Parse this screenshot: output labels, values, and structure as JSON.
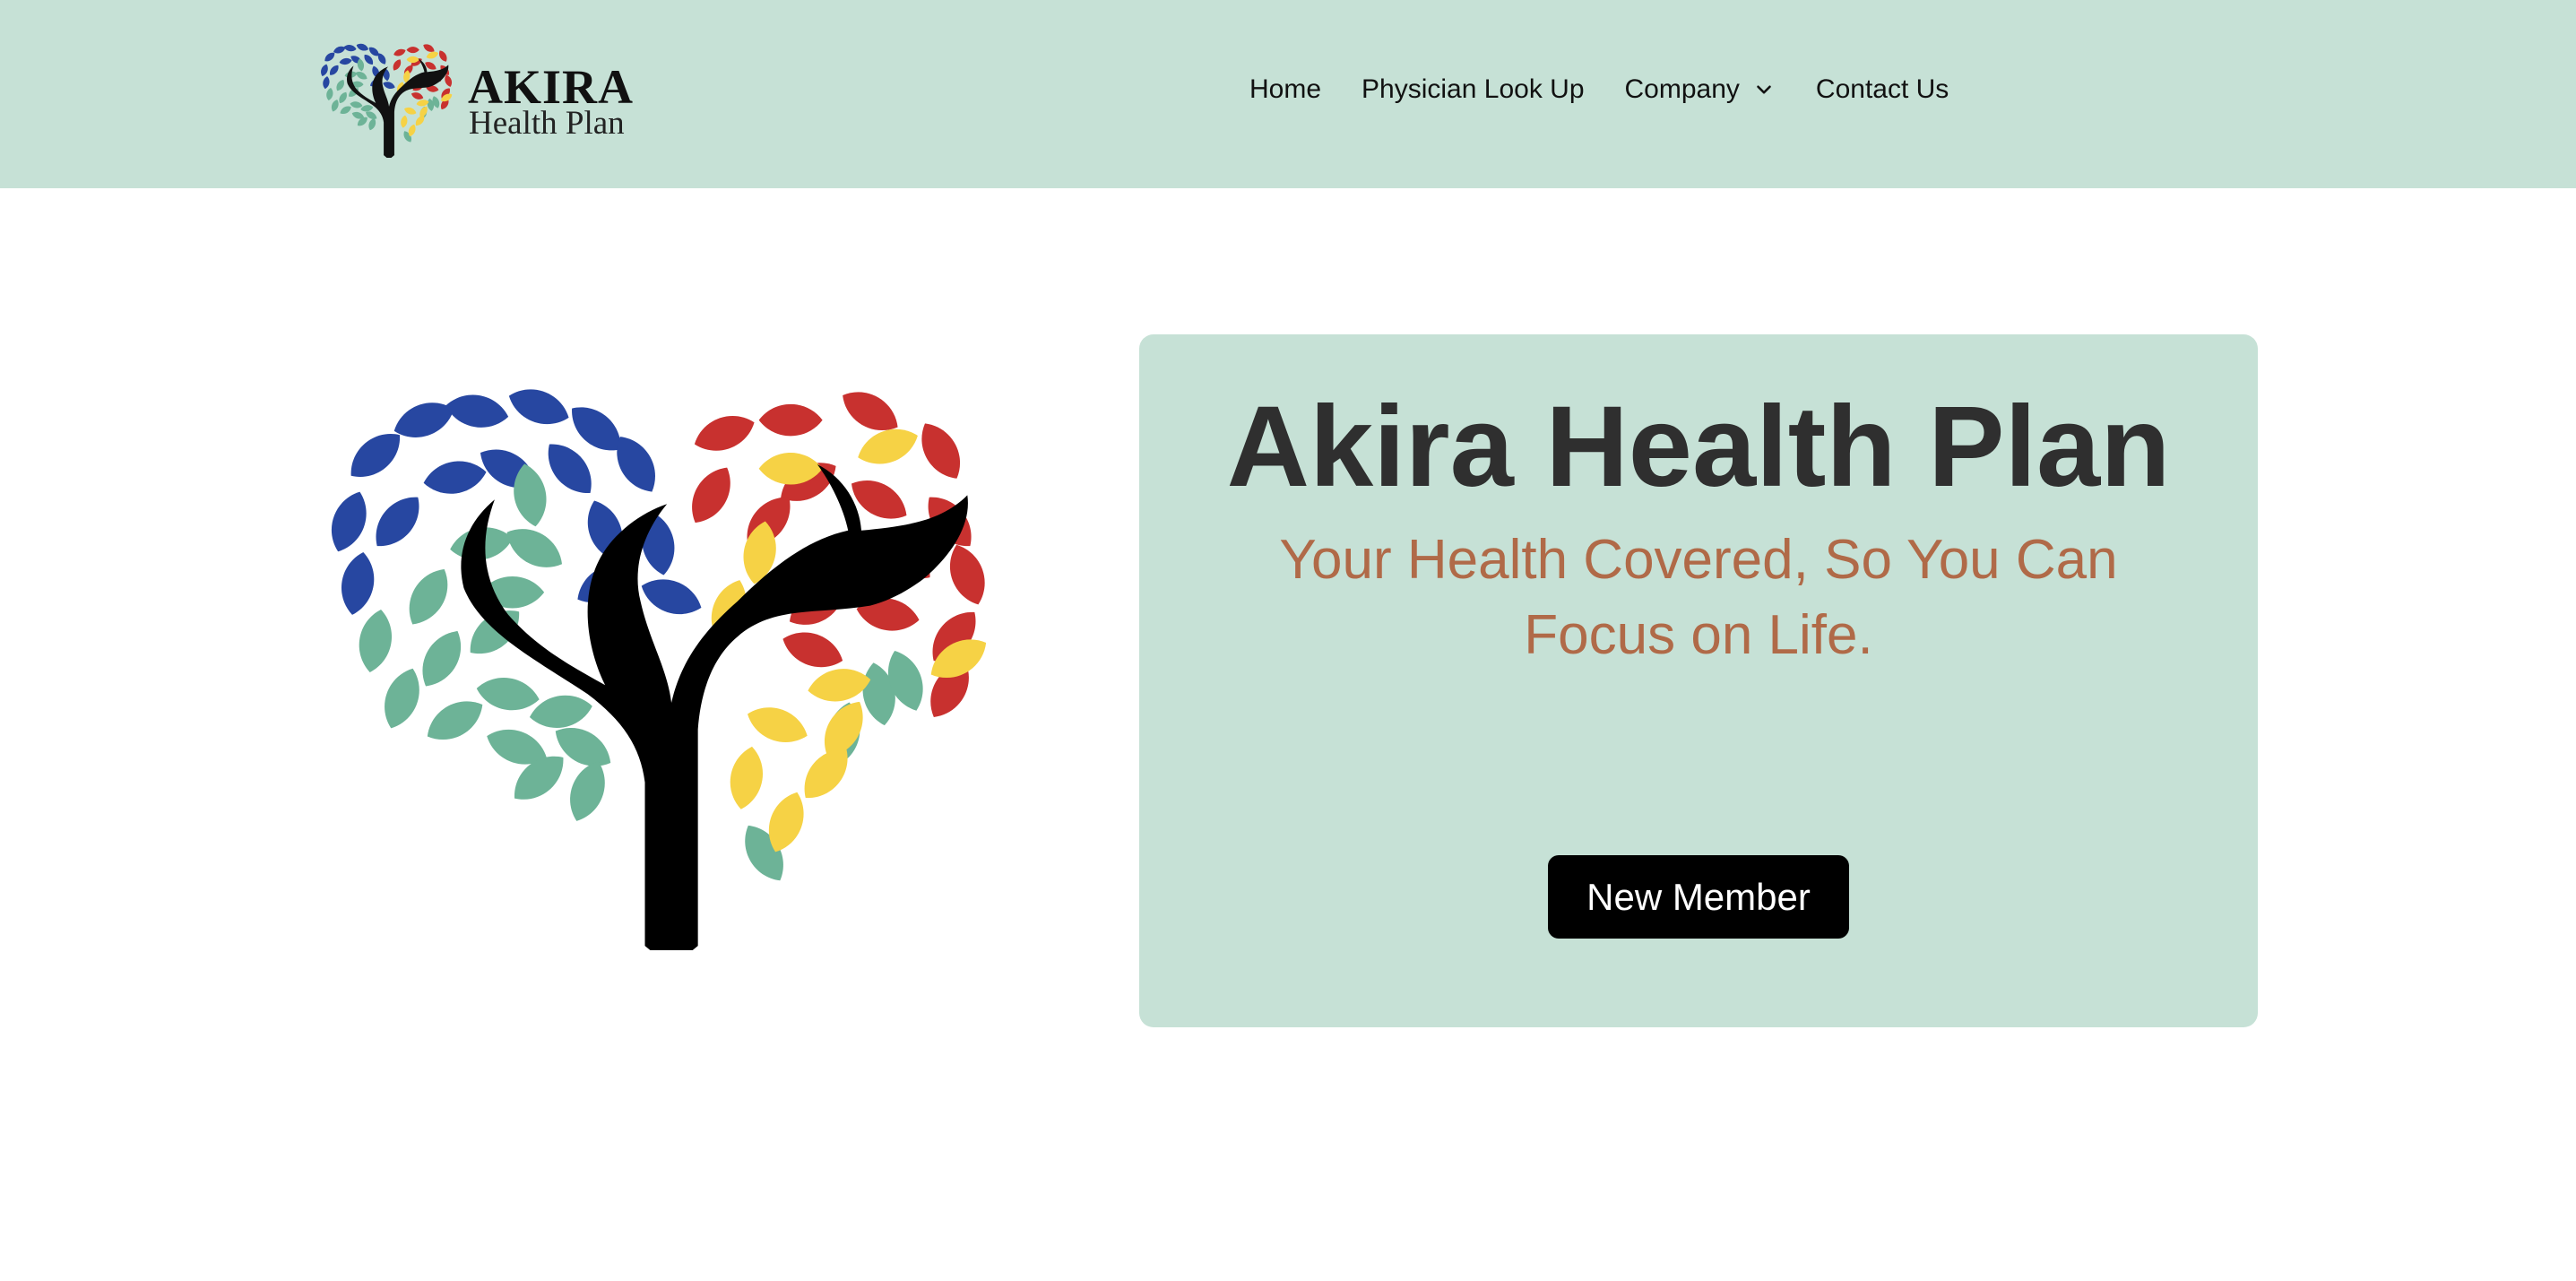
{
  "header": {
    "brand": {
      "name": "AKIRA",
      "subtitle": "Health Plan"
    },
    "nav": [
      {
        "label": "Home"
      },
      {
        "label": "Physician Look Up"
      },
      {
        "label": "Company",
        "has_dropdown": true,
        "icon": "chevron-down-icon"
      },
      {
        "label": "Contact Us"
      }
    ]
  },
  "hero": {
    "image": "heart-tree-illustration",
    "title": "Akira Health Plan",
    "tagline": "Your Health Covered, So You Can Focus on Life.",
    "cta_label": "New Member"
  },
  "colors": {
    "header_bg": "#c6e1d6",
    "card_bg": "#c6e1d6",
    "title_text": "#2f2f2f",
    "tagline_text": "#b06a48",
    "button_bg": "#000000",
    "button_text": "#ffffff",
    "leaf_blue": "#2747a1",
    "leaf_green": "#6db397",
    "leaf_red": "#c8312f",
    "leaf_yellow": "#f6d245"
  }
}
